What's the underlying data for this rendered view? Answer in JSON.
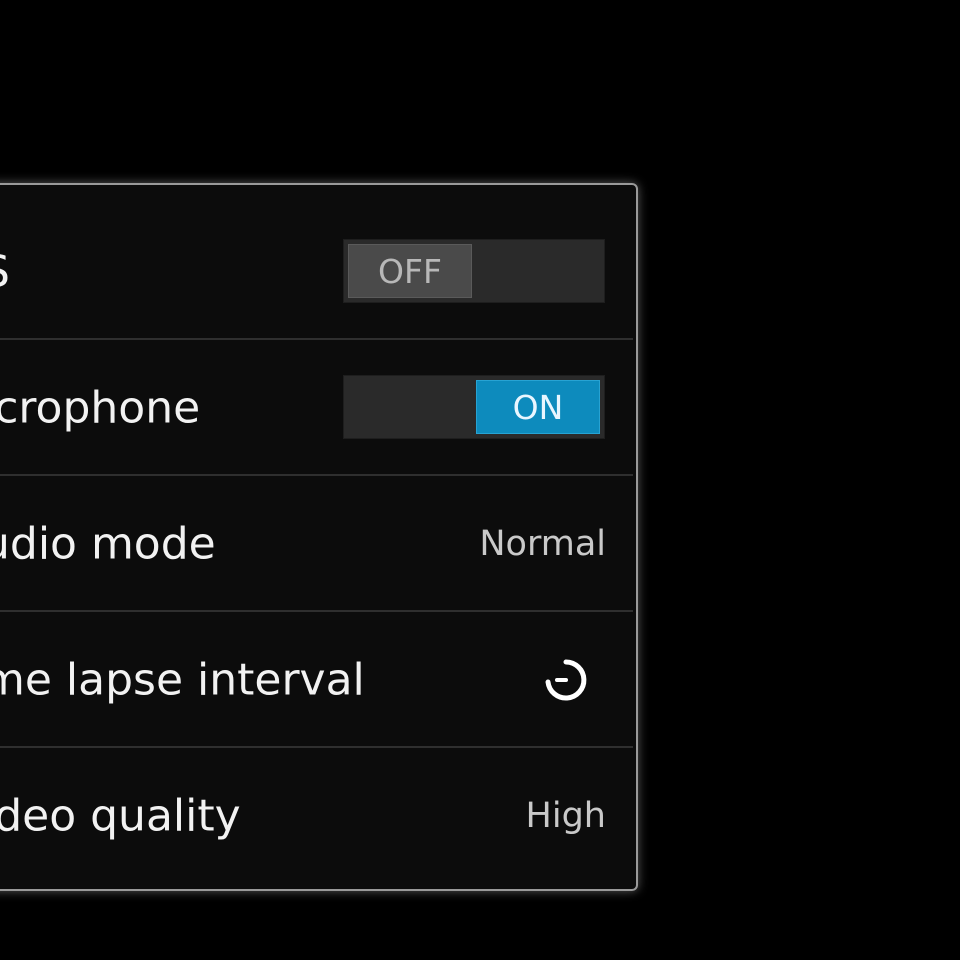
{
  "settings": {
    "items": [
      {
        "label": "S",
        "control": "toggle",
        "state_label": "OFF"
      },
      {
        "label": "icrophone",
        "control": "toggle",
        "state_label": "ON"
      },
      {
        "label": "udio mode",
        "control": "value",
        "value": "Normal"
      },
      {
        "label": "me lapse interval",
        "control": "spinner-icon"
      },
      {
        "label": "ideo quality",
        "control": "value",
        "value": "High"
      }
    ]
  },
  "colors": {
    "background": "#000000",
    "panel": "#0c0c0c",
    "toggle_on": "#0d8bbd",
    "toggle_off": "#4a4a4a"
  }
}
